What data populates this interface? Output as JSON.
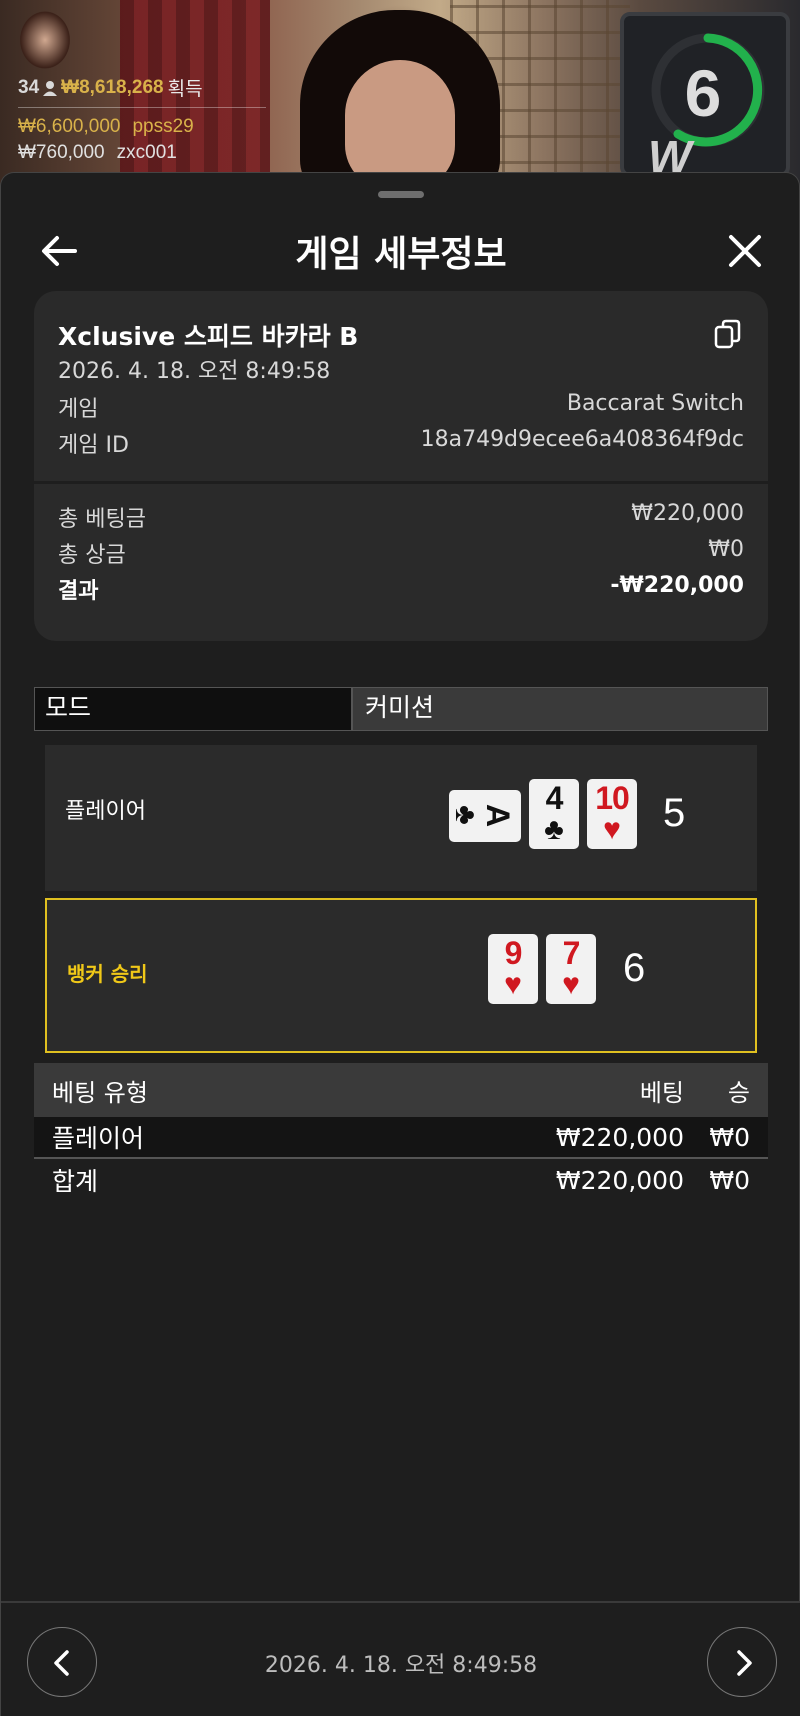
{
  "stream": {
    "timer": "6",
    "logo": "W",
    "winners": {
      "count": "34",
      "total": "₩8,618,268",
      "total_label": "획득",
      "entries": [
        {
          "amount": "₩6,600,000",
          "user": "ppss29"
        },
        {
          "amount": "₩760,000",
          "user": "zxc001"
        }
      ]
    }
  },
  "header": {
    "title": "게임 세부정보",
    "back_icon": "arrow-left-icon",
    "close_icon": "close-icon"
  },
  "summary": {
    "game_name": "Xclusive 스피드 바카라 B",
    "datetime": "2026. 4. 18. 오전 8:49:58",
    "game_label": "게임",
    "game_value": "Baccarat Switch",
    "game_id_label": "게임 ID",
    "game_id_value": "18a749d9ecee6a408364f9dc",
    "total_bet_label": "총 베팅금",
    "total_bet_value": "₩220,000",
    "total_win_label": "총 상금",
    "total_win_value": "₩0",
    "result_label": "결과",
    "result_value": "-₩220,000"
  },
  "mode": {
    "label": "모드",
    "value": "커미션"
  },
  "hands": {
    "player": {
      "label": "플레이어",
      "score": "5",
      "cards": [
        {
          "rank": "A",
          "suit": "♣",
          "color": "black",
          "rotated": true
        },
        {
          "rank": "4",
          "suit": "♣",
          "color": "black",
          "rotated": false
        },
        {
          "rank": "10",
          "suit": "♥",
          "color": "red",
          "rotated": false
        }
      ]
    },
    "banker": {
      "label": "뱅커 승리",
      "score": "6",
      "cards": [
        {
          "rank": "9",
          "suit": "♥",
          "color": "red",
          "rotated": false
        },
        {
          "rank": "7",
          "suit": "♥",
          "color": "red",
          "rotated": false
        }
      ]
    }
  },
  "bets": {
    "headers": {
      "type": "베팅 유형",
      "bet": "베팅",
      "win": "승"
    },
    "rows": [
      {
        "type": "플레이어",
        "bet": "₩220,000",
        "win": "₩0"
      }
    ],
    "total": {
      "type": "합계",
      "bet": "₩220,000",
      "win": "₩0"
    }
  },
  "footer": {
    "datetime": "2026. 4. 18. 오전 8:49:58",
    "prev_icon": "chevron-left-icon",
    "next_icon": "chevron-right-icon"
  },
  "colors": {
    "accent_gold": "#d9b24a",
    "banker_highlight": "#e0c020",
    "timer_green": "#22b14c",
    "card_red": "#d01820"
  }
}
